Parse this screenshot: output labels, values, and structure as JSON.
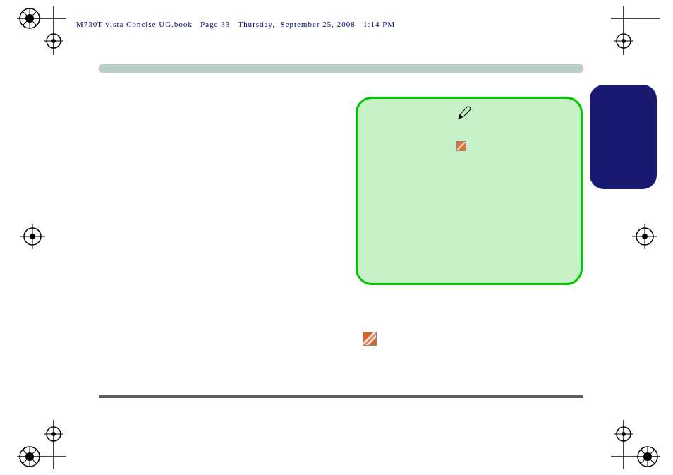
{
  "header": {
    "book": "M730T vista Concise UG.book",
    "page_label": "Page 33",
    "day": "Thursday,",
    "date": "September 25, 2008",
    "time": "1:14 PM"
  },
  "icons": {
    "pen": "pen-icon",
    "orange_small": "orange-square-icon",
    "orange_big": "orange-square-icon"
  },
  "colors": {
    "top_bar": "#bacdc8",
    "green_box_fill": "#c8f0c8",
    "green_box_border": "#00c800",
    "blue_tab": "#191970",
    "header_text": "#000080"
  }
}
